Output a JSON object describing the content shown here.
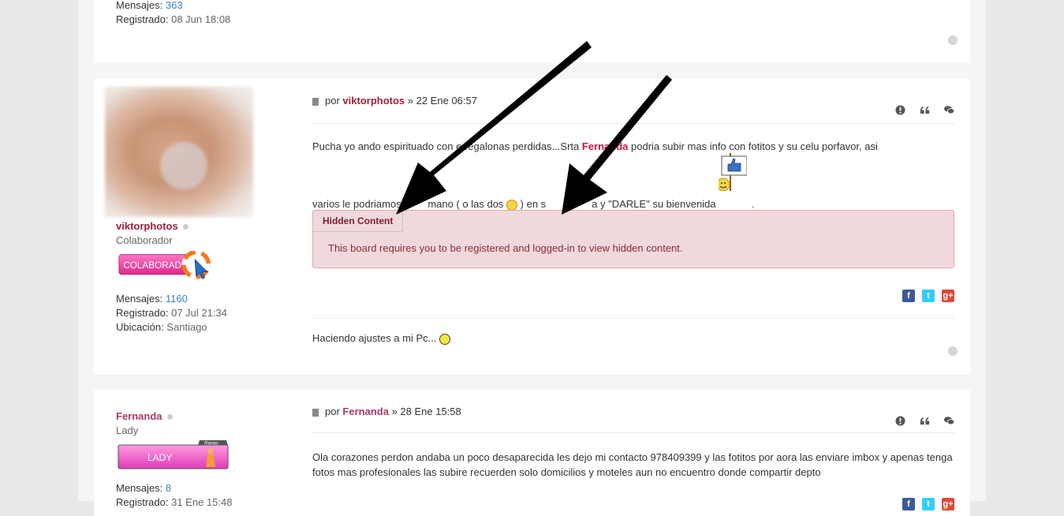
{
  "post1": {
    "posts_label": "Mensajes:",
    "posts_value": "363",
    "registered_label": "Registrado:",
    "registered_value": "08 Jun 18:08"
  },
  "post2": {
    "username": "viktorphotos",
    "rank": "Colaborador",
    "rank_badge": "COLABORADOR",
    "posts_label": "Mensajes:",
    "posts_value": "1160",
    "registered_label": "Registrado:",
    "registered_value": "07 Jul 21:34",
    "location_label": "Ubicación:",
    "location_value": "Santiago",
    "head_by": "por",
    "head_author": "viktorphotos",
    "head_date": "» 22 Ene 06:57",
    "text_a": "Pucha yo ando espirituado con ",
    "text_b": "e regalonas perdidas...Srta ",
    "text_name": "Fernanda",
    "text_c": " podria subir mas info con fotitos y su celu porfavor, asi",
    "text_d": "varios le podriamos ",
    "text_e": "mano ( o las dos ",
    "text_f": " ) en s",
    "text_g": "a y \"DARLE\" su bienvenida ",
    "text_h": ".",
    "hidden_title": "Hidden Content",
    "hidden_message": "This board requires you to be registered and logged-in to view hidden content.",
    "signature": "Haciendo ajustes a mi Pc... "
  },
  "post3": {
    "username": "Fernanda",
    "rank": "Lady",
    "rank_badge": "LADY",
    "rank_badge_tag": "Rango",
    "posts_label": "Mensajes:",
    "posts_value": "8",
    "registered_label": "Registrado:",
    "registered_value": "31 Ene 15:48",
    "head_by": "por",
    "head_author": "Fernanda",
    "head_date": "» 28 Ene 15:58",
    "text": "Ola corazones perdon andaba un poco desaparecida les dejo mi contacto 978409399 y las fotitos por aora las enviare imbox y apenas tenga fotos mas profesionales las subire recuerden solo domicilios y moteles aun no encuentro donde compartir depto"
  },
  "icons": {
    "report": "exclamation-circle-icon",
    "quote": "quote-icon",
    "reply": "comments-icon",
    "facebook": "facebook-icon",
    "twitter": "twitter-icon",
    "googleplus": "google-plus-icon",
    "back_to_top": "chevron-up-circle-icon"
  },
  "colors": {
    "username_dark": "#a0213a",
    "username_purple": "#a63a6a",
    "link": "#3d83c2",
    "hidden_bg": "#f0d9dc",
    "hidden_border": "#e1a9b3"
  }
}
